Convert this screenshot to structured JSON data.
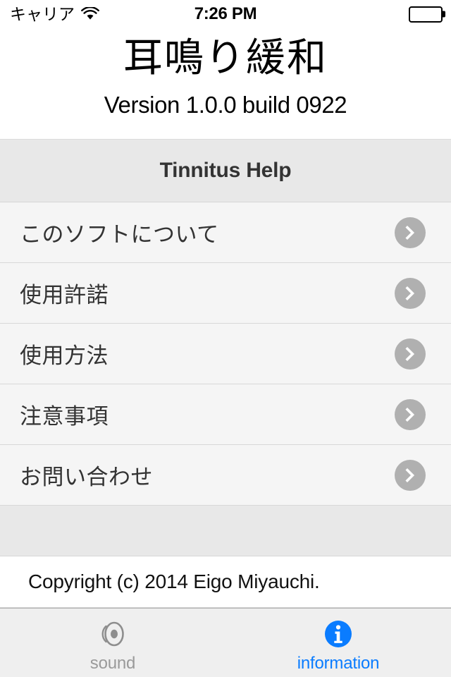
{
  "status_bar": {
    "carrier": "キャリア",
    "wifi_icon": "wifi-icon",
    "time": "7:26 PM",
    "battery_icon": "battery-full-icon"
  },
  "header": {
    "app_title": "耳鳴り緩和",
    "version": "Version 1.0.0 build 0922"
  },
  "table": {
    "section_header": "Tinnitus Help",
    "rows": [
      {
        "label": "このソフトについて",
        "accessory": "chevron-right-icon"
      },
      {
        "label": "使用許諾",
        "accessory": "chevron-right-icon"
      },
      {
        "label": "使用方法",
        "accessory": "chevron-right-icon"
      },
      {
        "label": "注意事項",
        "accessory": "chevron-right-icon"
      },
      {
        "label": "お問い合わせ",
        "accessory": "chevron-right-icon"
      }
    ],
    "copyright": "Copyright (c) 2014 Eigo Miyauchi."
  },
  "tab_bar": {
    "tabs": [
      {
        "label": "sound",
        "icon": "speaker-icon",
        "active": false
      },
      {
        "label": "information",
        "icon": "info-circle-icon",
        "active": true
      }
    ],
    "active_color": "#0a7cff",
    "inactive_color": "#9a9a9a"
  }
}
